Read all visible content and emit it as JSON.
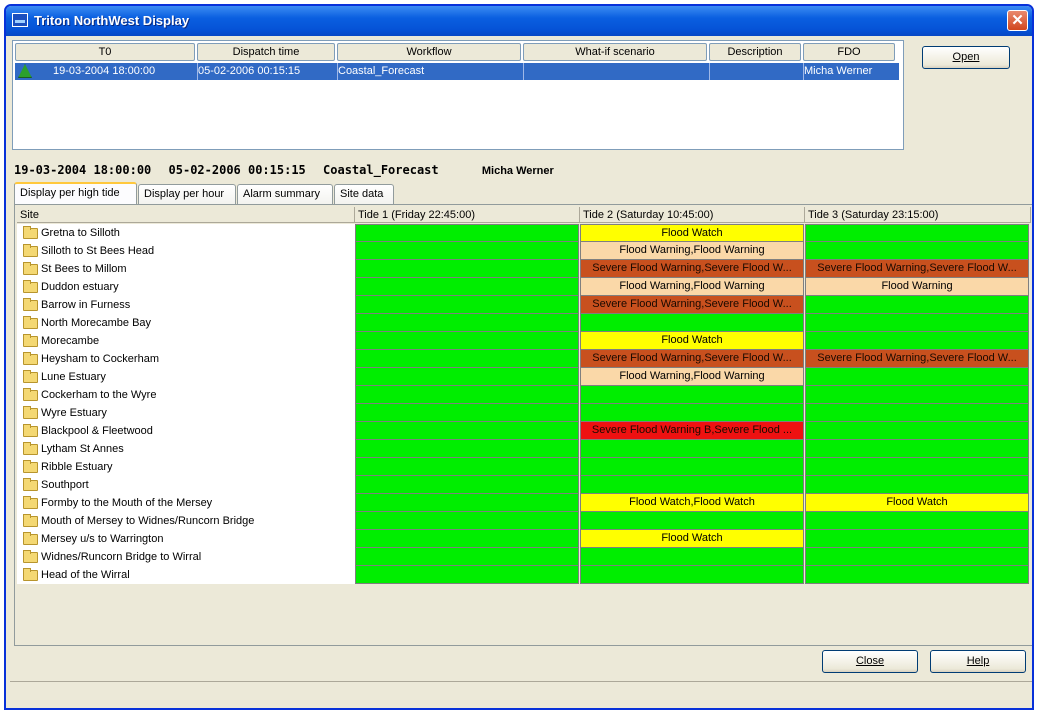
{
  "window": {
    "title": "Triton NorthWest Display"
  },
  "dispatch": {
    "headers": [
      "T0",
      "Dispatch time",
      "Workflow",
      "What-if scenario",
      "Description",
      "FDO"
    ],
    "row": {
      "t0": "19-03-2004 18:00:00",
      "dispatch_time": "05-02-2006 00:15:15",
      "workflow": "Coastal_Forecast",
      "what_if": "",
      "description": "",
      "fdo": "Micha Werner"
    }
  },
  "buttons": {
    "open": "Open",
    "close": "Close",
    "help": "Help"
  },
  "summary": {
    "t0": "19-03-2004 18:00:00",
    "dispatch_time": "05-02-2006 00:15:15",
    "workflow": "Coastal_Forecast",
    "fdo": "Micha Werner"
  },
  "tabs": [
    "Display per high tide",
    "Display per hour",
    "Alarm summary",
    "Site data"
  ],
  "grid": {
    "site_header": "Site",
    "tide_headers": [
      "Tide 1 (Friday 22:45:00)",
      "Tide 2 (Saturday 10:45:00)",
      "Tide 3 (Saturday 23:15:00)"
    ],
    "status_colors": {
      "none": "#00ee00",
      "watch": "#ffff00",
      "warning": "#fad8a8",
      "severe": "#c8501e",
      "extreme": "#ee1111"
    },
    "rows": [
      {
        "site": "Gretna to Silloth",
        "tides": [
          {
            "text": "",
            "level": "none"
          },
          {
            "text": "Flood Watch",
            "level": "watch"
          },
          {
            "text": "",
            "level": "none"
          }
        ]
      },
      {
        "site": "Silloth to St Bees Head",
        "tides": [
          {
            "text": "",
            "level": "none"
          },
          {
            "text": "Flood Warning,Flood Warning",
            "level": "warning"
          },
          {
            "text": "",
            "level": "none"
          }
        ]
      },
      {
        "site": "St Bees to Millom",
        "tides": [
          {
            "text": "",
            "level": "none"
          },
          {
            "text": "Severe Flood Warning,Severe Flood W...",
            "level": "severe"
          },
          {
            "text": "Severe Flood Warning,Severe Flood W...",
            "level": "severe"
          }
        ]
      },
      {
        "site": "Duddon estuary",
        "tides": [
          {
            "text": "",
            "level": "none"
          },
          {
            "text": "Flood Warning,Flood Warning",
            "level": "warning"
          },
          {
            "text": "Flood Warning",
            "level": "warning"
          }
        ]
      },
      {
        "site": "Barrow in Furness",
        "tides": [
          {
            "text": "",
            "level": "none"
          },
          {
            "text": "Severe Flood Warning,Severe Flood W...",
            "level": "severe"
          },
          {
            "text": "",
            "level": "none"
          }
        ]
      },
      {
        "site": "North Morecambe Bay",
        "tides": [
          {
            "text": "",
            "level": "none"
          },
          {
            "text": "",
            "level": "none"
          },
          {
            "text": "",
            "level": "none"
          }
        ]
      },
      {
        "site": "Morecambe",
        "tides": [
          {
            "text": "",
            "level": "none"
          },
          {
            "text": "Flood Watch",
            "level": "watch"
          },
          {
            "text": "",
            "level": "none"
          }
        ]
      },
      {
        "site": "Heysham to Cockerham",
        "tides": [
          {
            "text": "",
            "level": "none"
          },
          {
            "text": "Severe Flood Warning,Severe Flood W...",
            "level": "severe"
          },
          {
            "text": "Severe Flood Warning,Severe Flood W...",
            "level": "severe"
          }
        ]
      },
      {
        "site": "Lune Estuary",
        "tides": [
          {
            "text": "",
            "level": "none"
          },
          {
            "text": "Flood Warning,Flood Warning",
            "level": "warning"
          },
          {
            "text": "",
            "level": "none"
          }
        ]
      },
      {
        "site": "Cockerham to the Wyre",
        "tides": [
          {
            "text": "",
            "level": "none"
          },
          {
            "text": "",
            "level": "none"
          },
          {
            "text": "",
            "level": "none"
          }
        ]
      },
      {
        "site": "Wyre Estuary",
        "tides": [
          {
            "text": "",
            "level": "none"
          },
          {
            "text": "",
            "level": "none"
          },
          {
            "text": "",
            "level": "none"
          }
        ]
      },
      {
        "site": "Blackpool & Fleetwood",
        "tides": [
          {
            "text": "",
            "level": "none"
          },
          {
            "text": "Severe Flood Warning B,Severe Flood ...",
            "level": "extreme"
          },
          {
            "text": "",
            "level": "none"
          }
        ]
      },
      {
        "site": "Lytham St Annes",
        "tides": [
          {
            "text": "",
            "level": "none"
          },
          {
            "text": "",
            "level": "none"
          },
          {
            "text": "",
            "level": "none"
          }
        ]
      },
      {
        "site": "Ribble Estuary",
        "tides": [
          {
            "text": "",
            "level": "none"
          },
          {
            "text": "",
            "level": "none"
          },
          {
            "text": "",
            "level": "none"
          }
        ]
      },
      {
        "site": "Southport",
        "tides": [
          {
            "text": "",
            "level": "none"
          },
          {
            "text": "",
            "level": "none"
          },
          {
            "text": "",
            "level": "none"
          }
        ]
      },
      {
        "site": "Formby to the Mouth of the Mersey",
        "tides": [
          {
            "text": "",
            "level": "none"
          },
          {
            "text": "Flood Watch,Flood Watch",
            "level": "watch"
          },
          {
            "text": "Flood Watch",
            "level": "watch"
          }
        ]
      },
      {
        "site": "Mouth of Mersey to Widnes/Runcorn Bridge",
        "tides": [
          {
            "text": "",
            "level": "none"
          },
          {
            "text": "",
            "level": "none"
          },
          {
            "text": "",
            "level": "none"
          }
        ]
      },
      {
        "site": "Mersey u/s to Warrington",
        "tides": [
          {
            "text": "",
            "level": "none"
          },
          {
            "text": "Flood Watch",
            "level": "watch"
          },
          {
            "text": "",
            "level": "none"
          }
        ]
      },
      {
        "site": "Widnes/Runcorn Bridge to Wirral",
        "tides": [
          {
            "text": "",
            "level": "none"
          },
          {
            "text": "",
            "level": "none"
          },
          {
            "text": "",
            "level": "none"
          }
        ]
      },
      {
        "site": "Head of the Wirral",
        "tides": [
          {
            "text": "",
            "level": "none"
          },
          {
            "text": "",
            "level": "none"
          },
          {
            "text": "",
            "level": "none"
          }
        ]
      }
    ]
  }
}
